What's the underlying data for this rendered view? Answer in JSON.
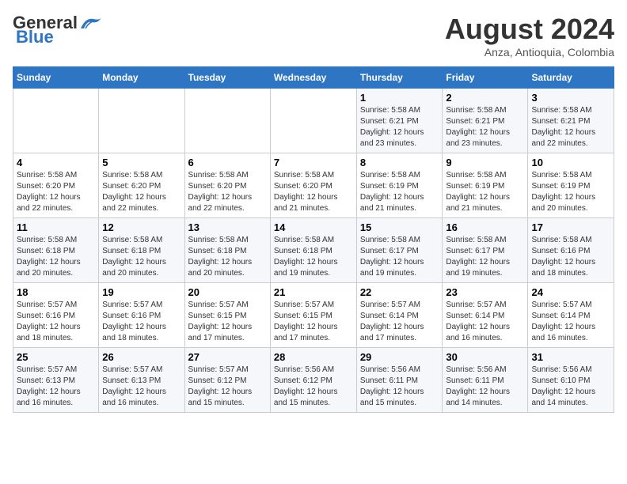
{
  "logo": {
    "line1": "General",
    "line2": "Blue"
  },
  "title": "August 2024",
  "subtitle": "Anza, Antioquia, Colombia",
  "weekdays": [
    "Sunday",
    "Monday",
    "Tuesday",
    "Wednesday",
    "Thursday",
    "Friday",
    "Saturday"
  ],
  "weeks": [
    [
      {
        "day": "",
        "info": ""
      },
      {
        "day": "",
        "info": ""
      },
      {
        "day": "",
        "info": ""
      },
      {
        "day": "",
        "info": ""
      },
      {
        "day": "1",
        "info": "Sunrise: 5:58 AM\nSunset: 6:21 PM\nDaylight: 12 hours\nand 23 minutes."
      },
      {
        "day": "2",
        "info": "Sunrise: 5:58 AM\nSunset: 6:21 PM\nDaylight: 12 hours\nand 23 minutes."
      },
      {
        "day": "3",
        "info": "Sunrise: 5:58 AM\nSunset: 6:21 PM\nDaylight: 12 hours\nand 22 minutes."
      }
    ],
    [
      {
        "day": "4",
        "info": "Sunrise: 5:58 AM\nSunset: 6:20 PM\nDaylight: 12 hours\nand 22 minutes."
      },
      {
        "day": "5",
        "info": "Sunrise: 5:58 AM\nSunset: 6:20 PM\nDaylight: 12 hours\nand 22 minutes."
      },
      {
        "day": "6",
        "info": "Sunrise: 5:58 AM\nSunset: 6:20 PM\nDaylight: 12 hours\nand 22 minutes."
      },
      {
        "day": "7",
        "info": "Sunrise: 5:58 AM\nSunset: 6:20 PM\nDaylight: 12 hours\nand 21 minutes."
      },
      {
        "day": "8",
        "info": "Sunrise: 5:58 AM\nSunset: 6:19 PM\nDaylight: 12 hours\nand 21 minutes."
      },
      {
        "day": "9",
        "info": "Sunrise: 5:58 AM\nSunset: 6:19 PM\nDaylight: 12 hours\nand 21 minutes."
      },
      {
        "day": "10",
        "info": "Sunrise: 5:58 AM\nSunset: 6:19 PM\nDaylight: 12 hours\nand 20 minutes."
      }
    ],
    [
      {
        "day": "11",
        "info": "Sunrise: 5:58 AM\nSunset: 6:18 PM\nDaylight: 12 hours\nand 20 minutes."
      },
      {
        "day": "12",
        "info": "Sunrise: 5:58 AM\nSunset: 6:18 PM\nDaylight: 12 hours\nand 20 minutes."
      },
      {
        "day": "13",
        "info": "Sunrise: 5:58 AM\nSunset: 6:18 PM\nDaylight: 12 hours\nand 20 minutes."
      },
      {
        "day": "14",
        "info": "Sunrise: 5:58 AM\nSunset: 6:18 PM\nDaylight: 12 hours\nand 19 minutes."
      },
      {
        "day": "15",
        "info": "Sunrise: 5:58 AM\nSunset: 6:17 PM\nDaylight: 12 hours\nand 19 minutes."
      },
      {
        "day": "16",
        "info": "Sunrise: 5:58 AM\nSunset: 6:17 PM\nDaylight: 12 hours\nand 19 minutes."
      },
      {
        "day": "17",
        "info": "Sunrise: 5:58 AM\nSunset: 6:16 PM\nDaylight: 12 hours\nand 18 minutes."
      }
    ],
    [
      {
        "day": "18",
        "info": "Sunrise: 5:57 AM\nSunset: 6:16 PM\nDaylight: 12 hours\nand 18 minutes."
      },
      {
        "day": "19",
        "info": "Sunrise: 5:57 AM\nSunset: 6:16 PM\nDaylight: 12 hours\nand 18 minutes."
      },
      {
        "day": "20",
        "info": "Sunrise: 5:57 AM\nSunset: 6:15 PM\nDaylight: 12 hours\nand 17 minutes."
      },
      {
        "day": "21",
        "info": "Sunrise: 5:57 AM\nSunset: 6:15 PM\nDaylight: 12 hours\nand 17 minutes."
      },
      {
        "day": "22",
        "info": "Sunrise: 5:57 AM\nSunset: 6:14 PM\nDaylight: 12 hours\nand 17 minutes."
      },
      {
        "day": "23",
        "info": "Sunrise: 5:57 AM\nSunset: 6:14 PM\nDaylight: 12 hours\nand 16 minutes."
      },
      {
        "day": "24",
        "info": "Sunrise: 5:57 AM\nSunset: 6:14 PM\nDaylight: 12 hours\nand 16 minutes."
      }
    ],
    [
      {
        "day": "25",
        "info": "Sunrise: 5:57 AM\nSunset: 6:13 PM\nDaylight: 12 hours\nand 16 minutes."
      },
      {
        "day": "26",
        "info": "Sunrise: 5:57 AM\nSunset: 6:13 PM\nDaylight: 12 hours\nand 16 minutes."
      },
      {
        "day": "27",
        "info": "Sunrise: 5:57 AM\nSunset: 6:12 PM\nDaylight: 12 hours\nand 15 minutes."
      },
      {
        "day": "28",
        "info": "Sunrise: 5:56 AM\nSunset: 6:12 PM\nDaylight: 12 hours\nand 15 minutes."
      },
      {
        "day": "29",
        "info": "Sunrise: 5:56 AM\nSunset: 6:11 PM\nDaylight: 12 hours\nand 15 minutes."
      },
      {
        "day": "30",
        "info": "Sunrise: 5:56 AM\nSunset: 6:11 PM\nDaylight: 12 hours\nand 14 minutes."
      },
      {
        "day": "31",
        "info": "Sunrise: 5:56 AM\nSunset: 6:10 PM\nDaylight: 12 hours\nand 14 minutes."
      }
    ]
  ]
}
